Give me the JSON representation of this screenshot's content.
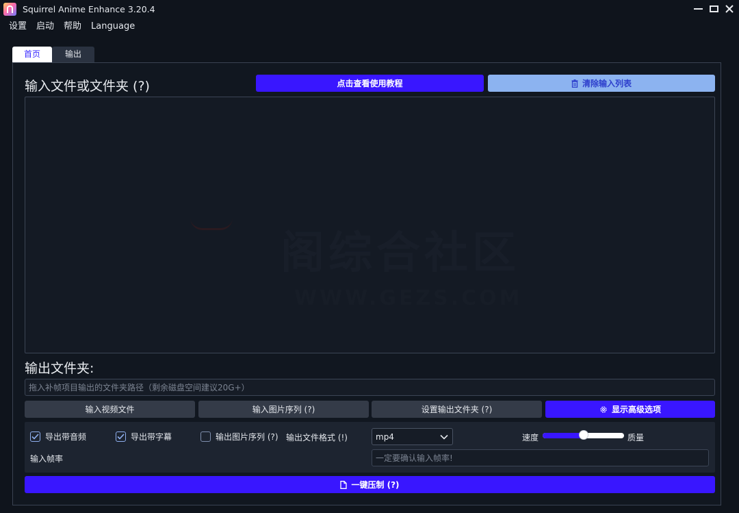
{
  "window": {
    "title": "Squirrel Anime Enhance 3.20.4"
  },
  "menu": {
    "items": [
      "设置",
      "启动",
      "帮助",
      "Language"
    ]
  },
  "tabs": [
    {
      "label": "首页",
      "active": true
    },
    {
      "label": "输出",
      "active": false
    }
  ],
  "input_section": {
    "label": "输入文件或文件夹 (?)",
    "tutorial_button": "点击查看使用教程",
    "clear_button": "清除输入列表",
    "watermark_main": "阁综合社区",
    "watermark_sub": "WWW.GEZS.COM"
  },
  "output_section": {
    "label": "输出文件夹:",
    "path_placeholder": "拖入补帧项目输出的文件夹路径（剩余磁盘空间建议20G+）",
    "path_value": ""
  },
  "action_buttons": {
    "input_video": "输入视频文件",
    "input_images": "输入图片序列 (?)",
    "set_output": "设置输出文件夹 (?)",
    "advanced": "显示高级选项"
  },
  "options": {
    "export_audio": {
      "label": "导出带音频",
      "checked": true
    },
    "export_subtitles": {
      "label": "导出带字幕",
      "checked": true
    },
    "export_image_sequence": {
      "label": "输出图片序列 (?)",
      "checked": false
    },
    "format_label": "输出文件格式 (!)",
    "format_value": "mp4",
    "speed_label": "速度",
    "quality_label": "质量",
    "speed_quality_level": 0.5,
    "fps_label": "输入帧率",
    "fps_placeholder": "一定要确认输入帧率!",
    "fps_value": ""
  },
  "run_button": "一键压制 (?)",
  "colors": {
    "accent": "#3916ff",
    "light_button": "#8cb3f0",
    "background": "#0f141c"
  }
}
